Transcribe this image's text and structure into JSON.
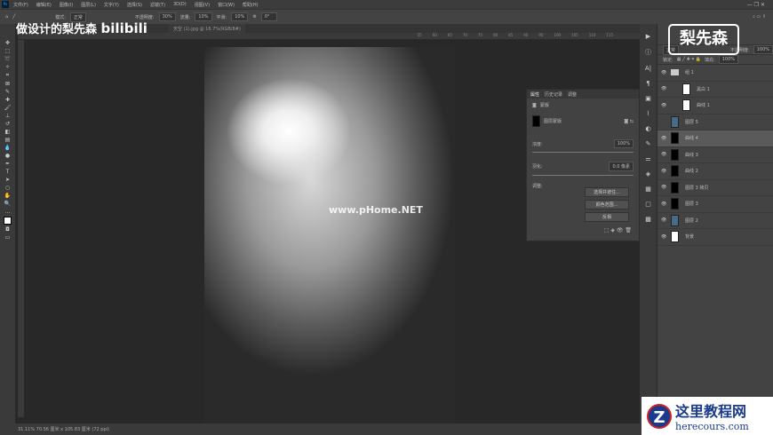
{
  "menu": [
    "文件(F)",
    "编辑(E)",
    "图像(I)",
    "图层(L)",
    "文字(Y)",
    "选择(S)",
    "滤镜(T)",
    "3D(D)",
    "视图(V)",
    "窗口(W)",
    "帮助(H)"
  ],
  "options": {
    "mode_label": "模式:",
    "mode": "正常",
    "opacity_label": "不透明度:",
    "opacity": "30%",
    "flow_label": "流量:",
    "flow": "10%",
    "smooth_label": "平滑:",
    "smooth": "10%",
    "angle": "0°"
  },
  "document_tab": "天空 (1).jpg @ 16.7%(RGB/8#)",
  "ruler_ticks": [
    "55",
    "60",
    "65",
    "70",
    "75",
    "80",
    "85",
    "90",
    "95",
    "100",
    "105",
    "110",
    "115"
  ],
  "canvas_watermark": "www.pHome.NET",
  "status": "31.11%  70.56 厘米 x 105.83 厘米 (72 ppi)",
  "properties": {
    "tabs": [
      "属性",
      "历史记录",
      "调整"
    ],
    "section": "蒙版",
    "mask_type": "图层蒙版",
    "density_label": "浓度:",
    "density": "100%",
    "feather_label": "羽化:",
    "feather": "0.0 像素",
    "adjust_label": "调整:",
    "buttons": [
      "选择并遮住...",
      "颜色范围...",
      "反相"
    ]
  },
  "layers_panel": {
    "opacity_label": "不透明度:",
    "opacity": "100%",
    "fill_label": "填充:",
    "fill": "100%",
    "lock_label": "锁定:",
    "blend": "正常",
    "items": [
      {
        "name": "组 1",
        "visible": true
      },
      {
        "name": "黑白 1",
        "visible": true
      },
      {
        "name": "曲线 1",
        "visible": true
      },
      {
        "name": "图层 5",
        "visible": false
      },
      {
        "name": "曲线 4",
        "visible": true,
        "selected": true
      },
      {
        "name": "曲线 3",
        "visible": true
      },
      {
        "name": "曲线 2",
        "visible": true
      },
      {
        "name": "图层 3 拷贝",
        "visible": true
      },
      {
        "name": "图层 3",
        "visible": true
      },
      {
        "name": "图层 2",
        "visible": true
      },
      {
        "name": "背景",
        "visible": true
      }
    ]
  },
  "overlay": {
    "channel": "做设计的梨先森",
    "bili": "bilibili",
    "logo": "梨先森",
    "site_cn": "这里教程网",
    "site_en": "herecours.com"
  }
}
